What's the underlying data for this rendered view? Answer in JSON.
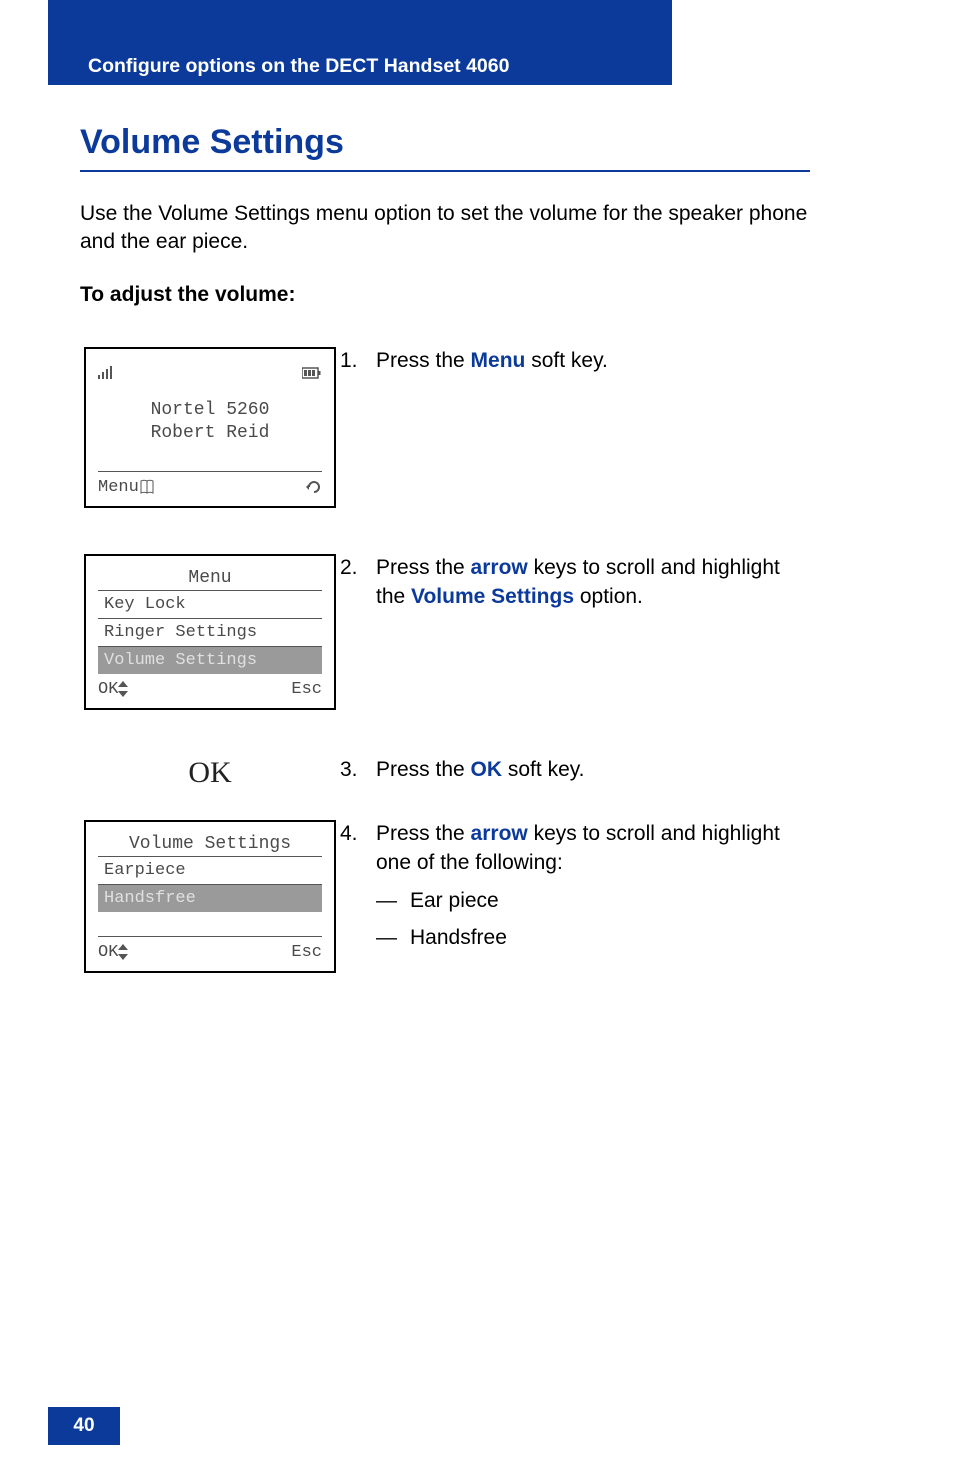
{
  "header": {
    "title": "Configure options on the DECT Handset 4060"
  },
  "page_number": "40",
  "section": {
    "title": "Volume Settings",
    "intro": "Use the Volume Settings menu option to set the volume for the speaker phone and the ear piece.",
    "sub_heading": "To adjust the volume:"
  },
  "steps": {
    "s1": {
      "num": "1.",
      "pre": "Press the ",
      "key": "Menu",
      "post": " soft key."
    },
    "s2": {
      "num": "2.",
      "pre": "Press the ",
      "key1": "arrow",
      "mid": " keys to scroll and highlight the ",
      "key2": "Volume Settings",
      "post": " option."
    },
    "s3": {
      "num": "3.",
      "pre": "Press the ",
      "key": "OK",
      "post": " soft key."
    },
    "s4": {
      "num": "4.",
      "pre": "Press the ",
      "key": "arrow",
      "mid": " keys to scroll and highlight one of the following:",
      "dash": "—",
      "items": {
        "a": "Ear piece",
        "b": "Handsfree"
      }
    }
  },
  "figures": {
    "ok_label": "OK",
    "idle": {
      "line1": "Nortel 5260",
      "line2": "Robert Reid",
      "soft_left": "Menu"
    },
    "menu": {
      "title": "Menu",
      "items": {
        "a": "Key Lock",
        "b": "Ringer Settings",
        "c": "Volume Settings"
      },
      "soft_left": "OK",
      "soft_right": "Esc"
    },
    "volume": {
      "title": "Volume Settings",
      "items": {
        "a": "Earpiece",
        "b": "Handsfree"
      },
      "soft_left": "OK",
      "soft_right": "Esc"
    }
  },
  "icons": {
    "signal": "signal-icon",
    "battery": "battery-icon",
    "book": "book-icon",
    "redial": "redial-icon",
    "updown": "updown-arrow-icon"
  }
}
